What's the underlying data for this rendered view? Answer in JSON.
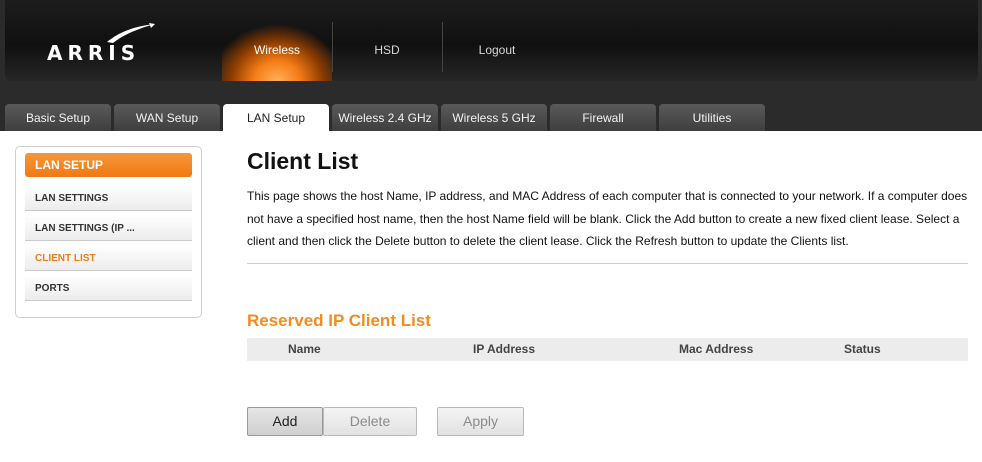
{
  "brand": {
    "logo_text": "ARRIS",
    "logo_icon": "arris-swoosh",
    "accent": "#f07d14"
  },
  "top_nav": [
    {
      "label": "Wireless",
      "active": true
    },
    {
      "label": "HSD",
      "active": false
    },
    {
      "label": "Logout",
      "active": false
    }
  ],
  "tabs": [
    {
      "label": "Basic Setup"
    },
    {
      "label": "WAN Setup"
    },
    {
      "label": "LAN Setup",
      "active": true
    },
    {
      "label": "Wireless 2.4 GHz"
    },
    {
      "label": "Wireless 5 GHz"
    },
    {
      "label": "Firewall"
    },
    {
      "label": "Utilities"
    }
  ],
  "sidebar": {
    "title": "LAN SETUP",
    "items": [
      {
        "label": "LAN SETTINGS"
      },
      {
        "label": "LAN SETTINGS (IP ..."
      },
      {
        "label": "CLIENT LIST",
        "active": true
      },
      {
        "label": "PORTS"
      }
    ]
  },
  "main": {
    "title": "Client List",
    "description": "This page shows the host Name, IP address, and MAC Address of each computer that is connected to your network. If a computer does not have a specified host name, then the host Name field will be blank. Click the Add button to create a new fixed client lease. Select a client and then click the Delete button to delete the client lease. Click the Refresh button to update the Clients list.",
    "section_title": "Reserved IP Client List",
    "table_headers": [
      "Name",
      "IP Address",
      "Mac Address",
      "Status"
    ],
    "buttons": {
      "add": "Add",
      "delete": "Delete",
      "apply": "Apply"
    }
  }
}
